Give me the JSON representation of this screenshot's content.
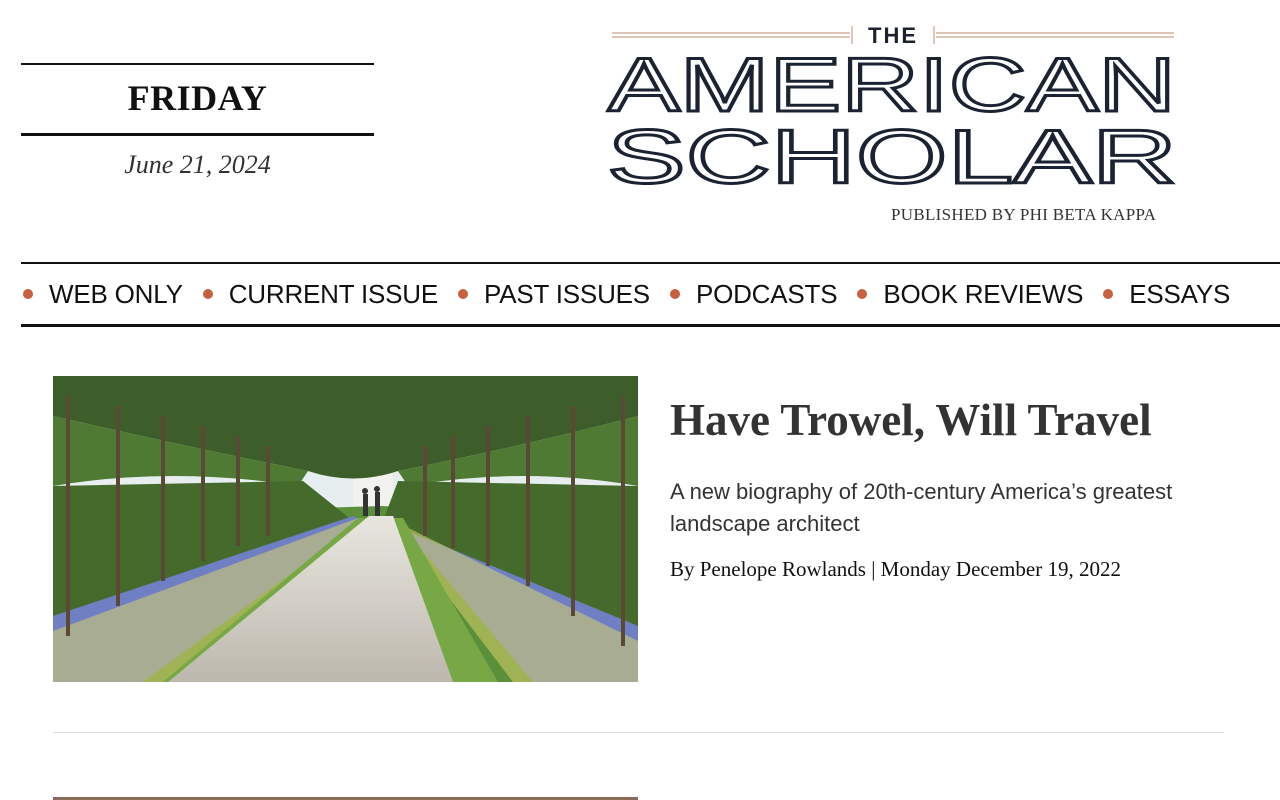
{
  "date": {
    "day": "FRIDAY",
    "full": "June 21, 2024"
  },
  "masthead": {
    "the": "THE",
    "line1": "AMERICAN",
    "line2": "SCHOLAR",
    "tagline": "PUBLISHED BY PHI BETA KAPPA"
  },
  "nav": {
    "items": [
      {
        "label": "WEB ONLY"
      },
      {
        "label": "CURRENT ISSUE"
      },
      {
        "label": "PAST ISSUES"
      },
      {
        "label": "PODCASTS"
      },
      {
        "label": "BOOK REVIEWS"
      },
      {
        "label": "ESSAYS"
      }
    ]
  },
  "article": {
    "title": "Have Trowel, Will Travel",
    "dek": "A new biography of 20th-century America’s greatest landscape architect",
    "byline": "By Penelope Rowlands | Monday December 19, 2022"
  },
  "colors": {
    "accent": "#c8603f",
    "rule": "#111111",
    "logo_ink": "#1b2333",
    "logo_rule": "#c9a48a"
  }
}
